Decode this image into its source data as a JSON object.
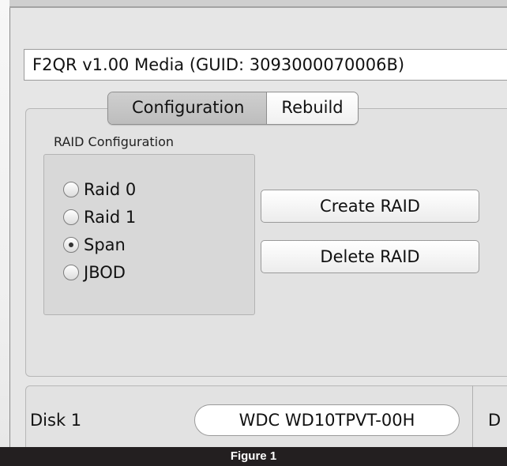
{
  "device": {
    "label": "F2QR v1.00 Media  (GUID: 3093000070006B)"
  },
  "tabs": [
    {
      "label": "Configuration",
      "selected": true
    },
    {
      "label": "Rebuild",
      "selected": false
    }
  ],
  "raid_group": {
    "title": "RAID Configuration",
    "options": [
      {
        "label": "Raid 0",
        "selected": false
      },
      {
        "label": "Raid 1",
        "selected": false
      },
      {
        "label": "Span",
        "selected": true
      },
      {
        "label": "JBOD",
        "selected": false
      }
    ]
  },
  "buttons": {
    "create": "Create RAID",
    "delete": "Delete RAID"
  },
  "disks": {
    "disk1_label": "Disk 1",
    "disk1_value": "WDC WD10TPVT-00H",
    "disk2_label_partial": "D"
  },
  "caption": "Figure 1"
}
